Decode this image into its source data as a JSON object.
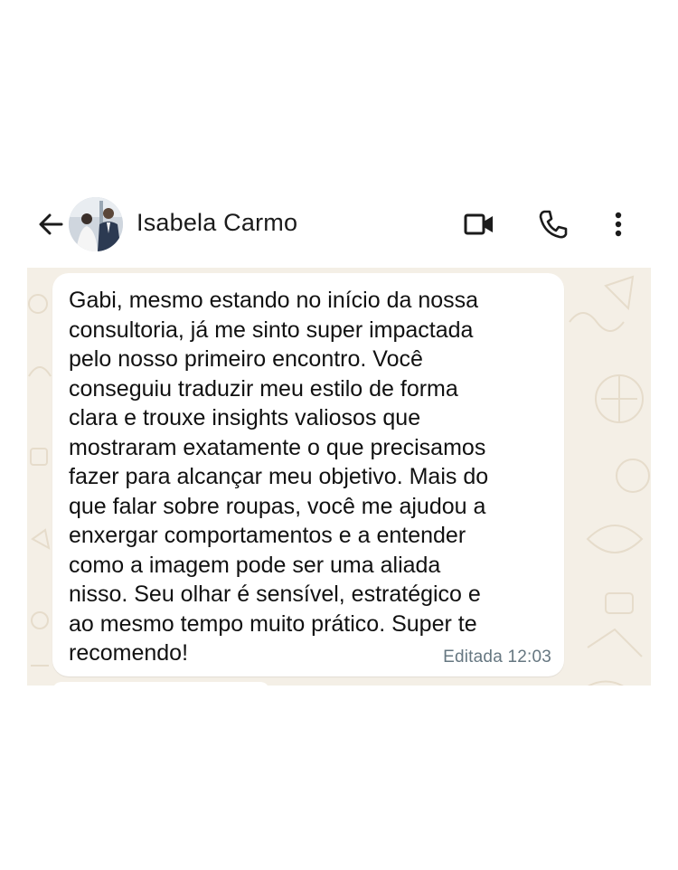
{
  "header": {
    "contact_name": "Isabela Carmo",
    "back_icon": "arrow-left-icon",
    "video_icon": "video-camera-icon",
    "call_icon": "phone-icon",
    "menu_icon": "more-vertical-icon"
  },
  "message": {
    "text": "Gabi, mesmo estando no início da nossa\nconsultoria, já me sinto super impactada\npelo nosso primeiro encontro. Você\nconseguiu traduzir meu estilo de forma\nclara e trouxe insights valiosos que\nmostraram exatamente o que precisamos\nfazer para alcançar meu objetivo. Mais do\nque falar sobre roupas, você me ajudou a\nenxergar comportamentos e a entender\ncomo a imagem pode ser uma aliada\nnisso. Seu olhar é sensível, estratégico e\nao mesmo tempo muito prático. Super te\nrecomendo!",
    "status": "Editada",
    "time": "12:03"
  },
  "colors": {
    "chat_background": "#f4efe6",
    "bubble": "#ffffff",
    "meta_text": "#667781",
    "icons": "#1b1b1b"
  }
}
